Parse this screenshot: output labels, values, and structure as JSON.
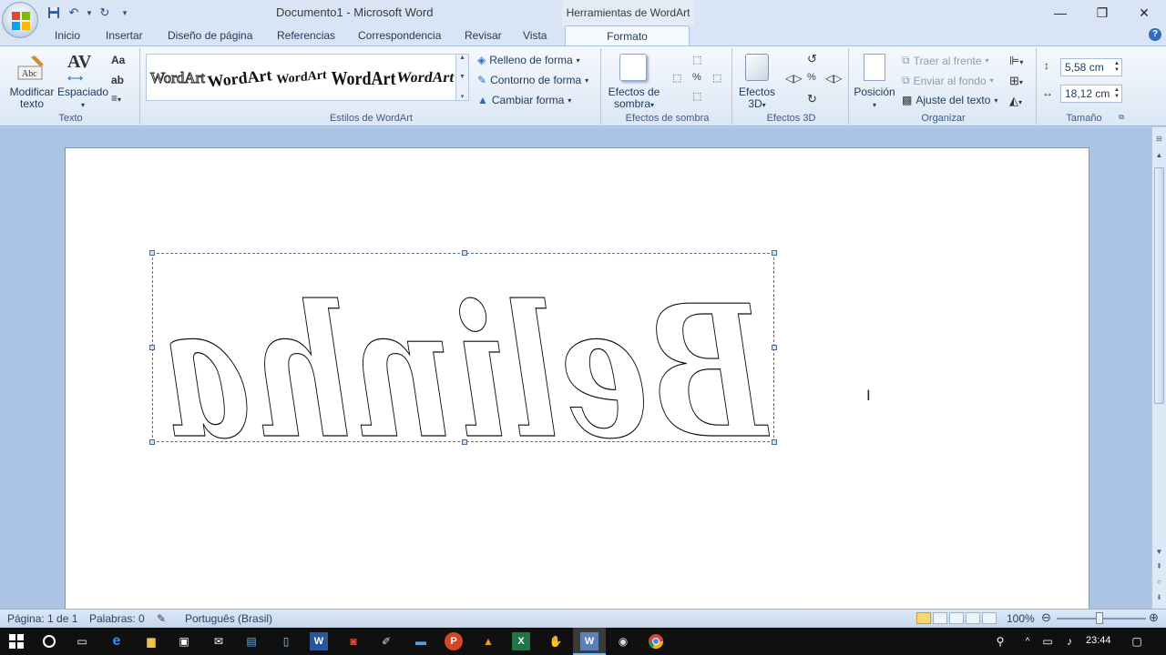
{
  "window": {
    "title": "Documento1 - Microsoft Word",
    "context_title": "Herramientas de WordArt"
  },
  "tabs": [
    {
      "label": "Inicio"
    },
    {
      "label": "Insertar"
    },
    {
      "label": "Diseño de página"
    },
    {
      "label": "Referencias"
    },
    {
      "label": "Correspondencia"
    },
    {
      "label": "Revisar"
    },
    {
      "label": "Vista"
    },
    {
      "label": "Formato"
    }
  ],
  "ribbon": {
    "texto": {
      "label": "Texto",
      "modificar_line1": "Modificar",
      "modificar_line2": "texto",
      "espaciado": "Espaciado"
    },
    "estilos": {
      "label": "Estilos de WordArt",
      "gallery": [
        "WordArt",
        "WordArt",
        "WordArt",
        "WordArt",
        "WordArt"
      ],
      "relleno": "Relleno de forma",
      "contorno": "Contorno de forma",
      "cambiar": "Cambiar forma"
    },
    "sombra": {
      "label": "Efectos de sombra",
      "button_line1": "Efectos de",
      "button_line2": "sombra"
    },
    "efectos3d": {
      "label": "Efectos 3D",
      "button_line1": "Efectos",
      "button_line2": "3D"
    },
    "organizar": {
      "label": "Organizar",
      "posicion": "Posición",
      "traer": "Traer al frente",
      "enviar": "Enviar al fondo",
      "ajuste": "Ajuste del texto"
    },
    "tamano": {
      "label": "Tamaño",
      "height": "5,58 cm",
      "width": "18,12 cm"
    }
  },
  "document": {
    "wordart_text": "Belinha",
    "mirrored": true
  },
  "status": {
    "page": "Página: 1 de 1",
    "words": "Palabras: 0",
    "language": "Português (Brasil)",
    "zoom": "100%"
  },
  "taskbar": {
    "time": "23:44"
  },
  "colors": {
    "ribbon_bg": "#dbe7f5",
    "doc_bg": "#abc4e3",
    "accent": "#2f6db8"
  }
}
